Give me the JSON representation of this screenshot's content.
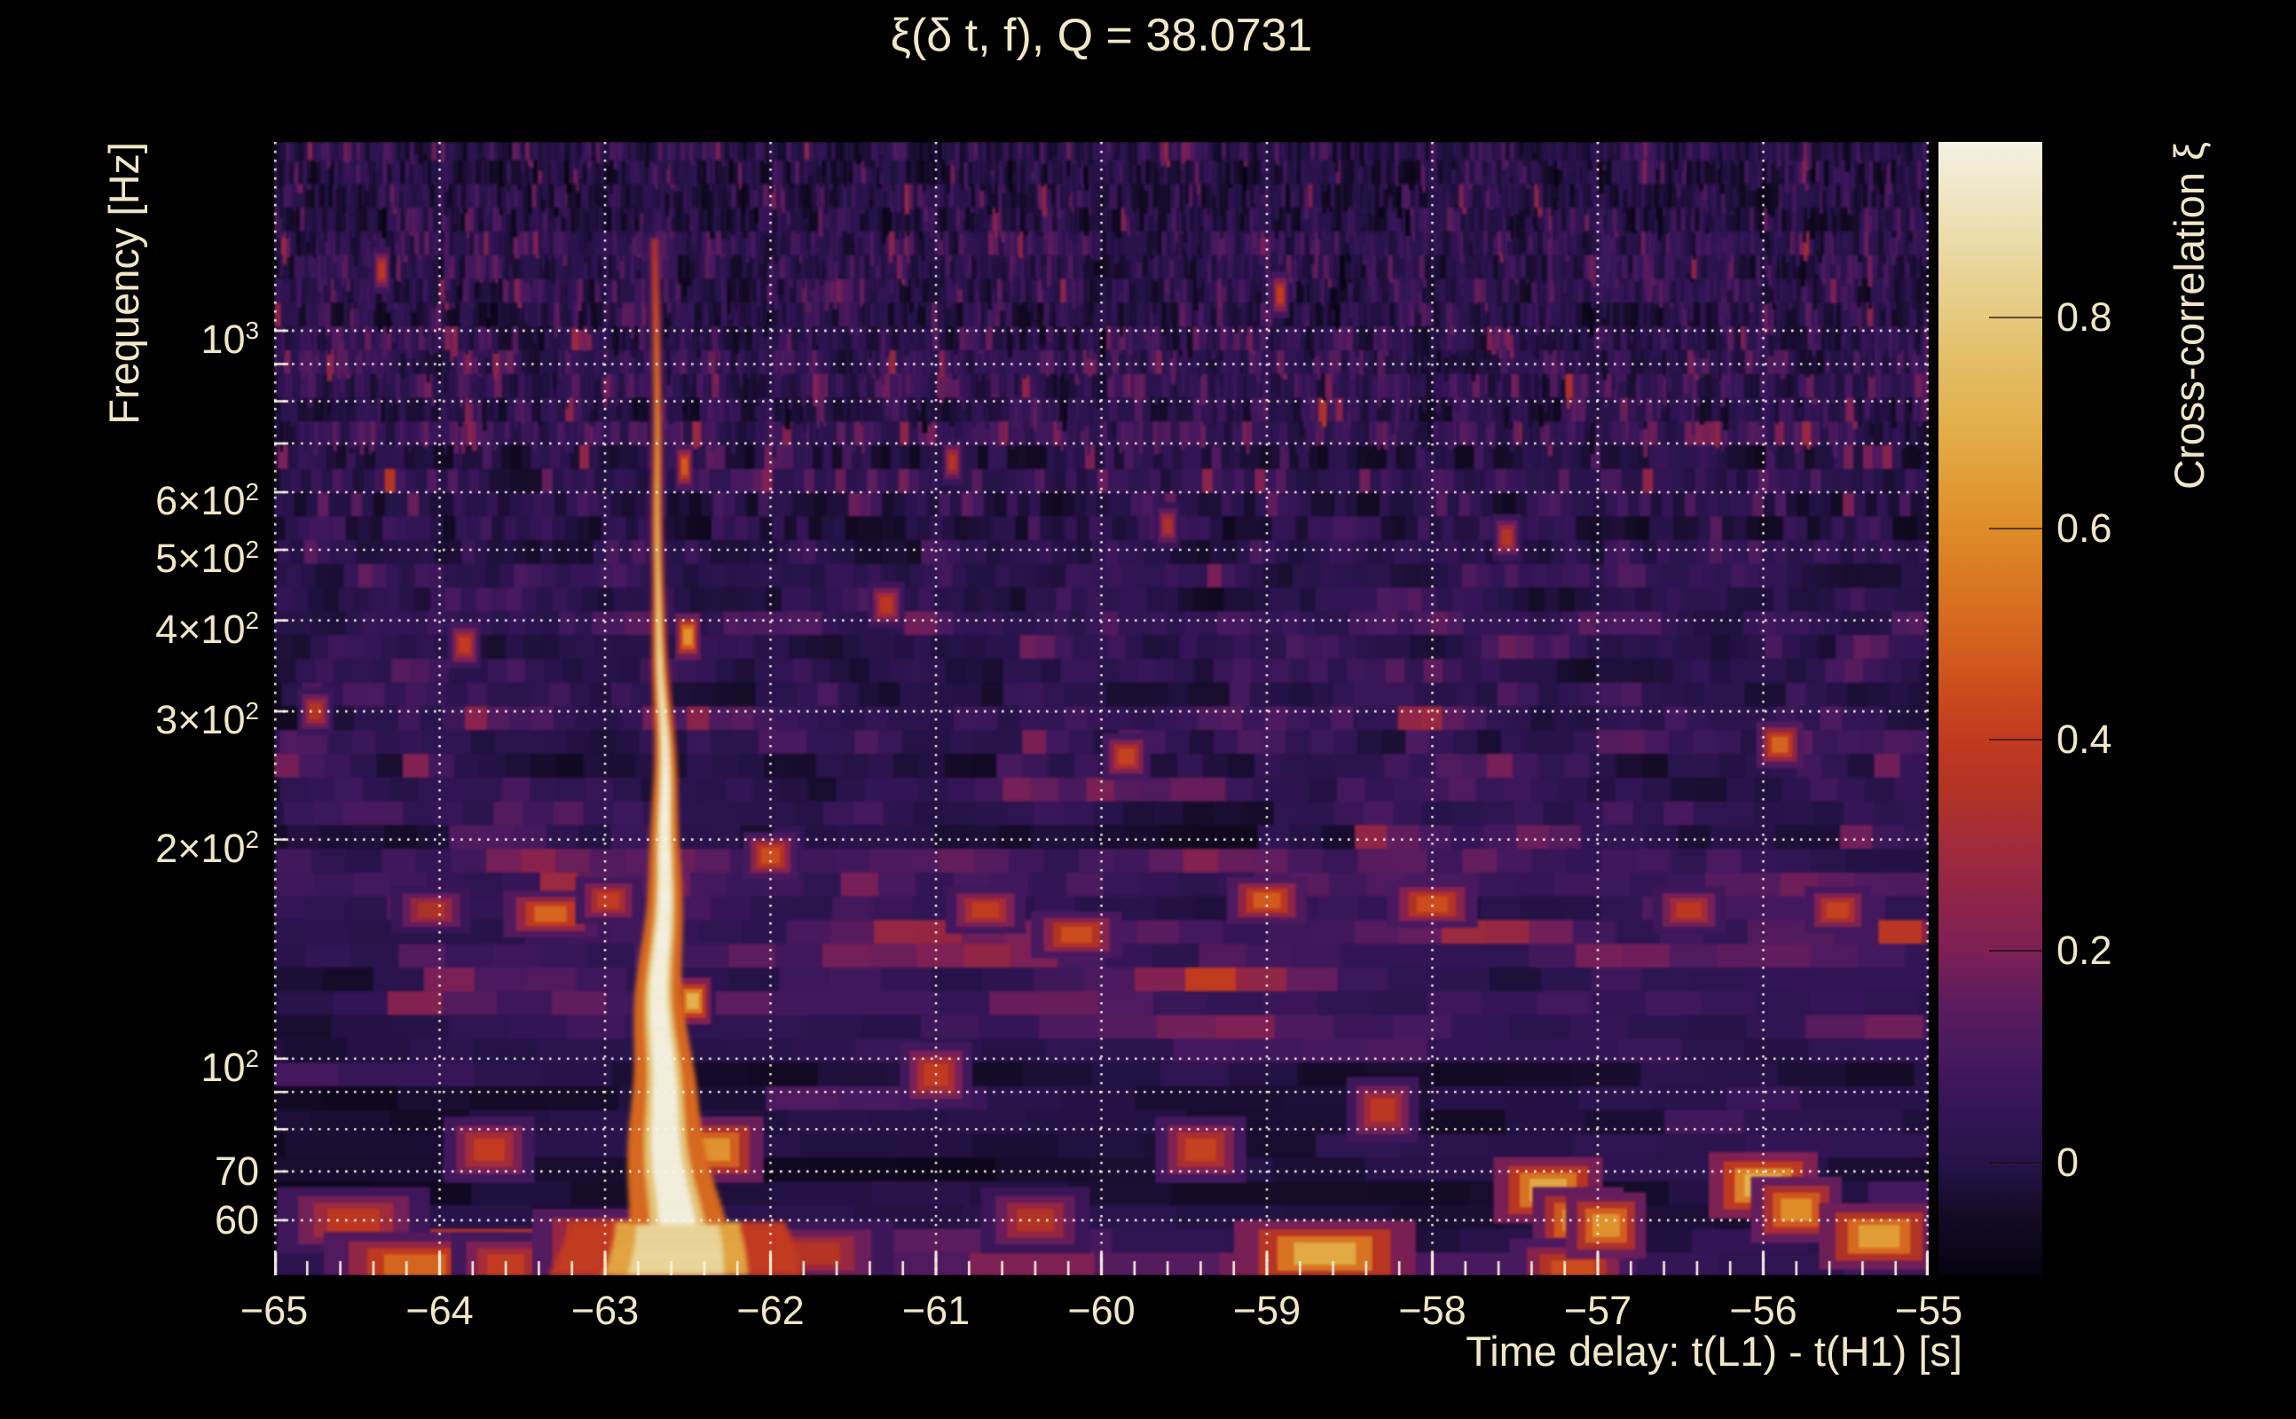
{
  "chart_data": {
    "type": "heatmap",
    "title": "ξ(δ t, f), Q = 38.0731",
    "q_value": 38.0731,
    "xlabel": "Time delay: t(L1) - t(H1) [s]",
    "ylabel": "Frequency [Hz]",
    "colorbar_label": "Cross-correlation ξ",
    "x_range_s": [
      -65,
      -55
    ],
    "x_minor_step_s": 0.2,
    "y_range_hz": [
      50.4,
      1817
    ],
    "y_scale": "log",
    "grid": "dotted white at integer seconds and at log-decade frequencies",
    "x_ticks": [
      {
        "value": -65,
        "label": "−65"
      },
      {
        "value": -64,
        "label": "−64"
      },
      {
        "value": -63,
        "label": "−63"
      },
      {
        "value": -62,
        "label": "−62"
      },
      {
        "value": -61,
        "label": "−61"
      },
      {
        "value": -60,
        "label": "−60"
      },
      {
        "value": -59,
        "label": "−59"
      },
      {
        "value": -58,
        "label": "−58"
      },
      {
        "value": -57,
        "label": "−57"
      },
      {
        "value": -56,
        "label": "−56"
      },
      {
        "value": -55,
        "label": "−55"
      }
    ],
    "y_grid_freqs_hz": [
      60,
      70,
      80,
      90,
      100,
      200,
      300,
      400,
      500,
      600,
      700,
      800,
      900,
      1000
    ],
    "y_tick_labels": [
      {
        "f": 1000,
        "base": "10",
        "exp": "3"
      },
      {
        "f": 600,
        "base": "6×10",
        "exp": "2"
      },
      {
        "f": 500,
        "base": "5×10",
        "exp": "2"
      },
      {
        "f": 400,
        "base": "4×10",
        "exp": "2"
      },
      {
        "f": 300,
        "base": "3×10",
        "exp": "2"
      },
      {
        "f": 200,
        "base": "2×10",
        "exp": "2"
      },
      {
        "f": 100,
        "base": "10",
        "exp": "2"
      },
      {
        "f": 70,
        "base": "70",
        "exp": ""
      },
      {
        "f": 60,
        "base": "60",
        "exp": ""
      }
    ],
    "colorbar": {
      "vmin": -0.107,
      "vmax": 0.966,
      "ticks": [
        {
          "value": 0.8,
          "label": "0.8"
        },
        {
          "value": 0.6,
          "label": "0.6"
        },
        {
          "value": 0.4,
          "label": "0.4"
        },
        {
          "value": 0.2,
          "label": "0.2"
        },
        {
          "value": 0,
          "label": "0"
        }
      ]
    },
    "colormap_stops": [
      [
        -0.107,
        "#060310"
      ],
      [
        -0.05,
        "#140b26"
      ],
      [
        0.0,
        "#261349"
      ],
      [
        0.05,
        "#331556"
      ],
      [
        0.1,
        "#47195f"
      ],
      [
        0.15,
        "#5c1c5e"
      ],
      [
        0.2,
        "#7d2055"
      ],
      [
        0.25,
        "#8f2448"
      ],
      [
        0.3,
        "#a02b3b"
      ],
      [
        0.35,
        "#b23325"
      ],
      [
        0.4,
        "#c23a20"
      ],
      [
        0.45,
        "#cc4c1d"
      ],
      [
        0.5,
        "#d5641e"
      ],
      [
        0.55,
        "#d97823"
      ],
      [
        0.6,
        "#de8c28"
      ],
      [
        0.65,
        "#e19e38"
      ],
      [
        0.7,
        "#e2b04c"
      ],
      [
        0.75,
        "#e3bb62"
      ],
      [
        0.8,
        "#e5c97e"
      ],
      [
        0.85,
        "#e9d69b"
      ],
      [
        0.9,
        "#eee2ba"
      ],
      [
        0.966,
        "#f4f1e4"
      ]
    ],
    "signal": {
      "description": "bright chirp track of high cross-correlation",
      "t_top_s": -62.7,
      "t_bottom_s": -62.6,
      "f_low_hz": 50,
      "f_high_hz": 1320,
      "peak_xi": 0.96
    },
    "hot_spots": [
      {
        "t": -64.52,
        "f": 60,
        "dt": 0.42,
        "v": 0.38
      },
      {
        "t": -64.15,
        "f": 52,
        "dt": 0.5,
        "v": 0.5
      },
      {
        "t": -64.05,
        "f": 160,
        "dt": 0.22,
        "v": 0.34
      },
      {
        "t": -64.35,
        "f": 1210,
        "dt": 0.05,
        "v": 0.38
      },
      {
        "t": -64.75,
        "f": 300,
        "dt": 0.1,
        "v": 0.36
      },
      {
        "t": -63.85,
        "f": 370,
        "dt": 0.09,
        "v": 0.4
      },
      {
        "t": -63.7,
        "f": 75,
        "dt": 0.25,
        "v": 0.4
      },
      {
        "t": -63.6,
        "f": 52,
        "dt": 0.3,
        "v": 0.4
      },
      {
        "t": -63.33,
        "f": 158,
        "dt": 0.26,
        "v": 0.5
      },
      {
        "t": -63.0,
        "f": 56,
        "dt": 0.4,
        "v": 0.52
      },
      {
        "t": -62.98,
        "f": 165,
        "dt": 0.18,
        "v": 0.4
      },
      {
        "t": -62.66,
        "f": 53,
        "dt": 0.5,
        "v": 0.55
      },
      {
        "t": -62.5,
        "f": 380,
        "dt": 0.07,
        "v": 0.62
      },
      {
        "t": -62.52,
        "f": 650,
        "dt": 0.05,
        "v": 0.48
      },
      {
        "t": -62.47,
        "f": 120,
        "dt": 0.1,
        "v": 0.7
      },
      {
        "t": -62.35,
        "f": 75,
        "dt": 0.28,
        "v": 0.62
      },
      {
        "t": -62.0,
        "f": 190,
        "dt": 0.15,
        "v": 0.45
      },
      {
        "t": -61.75,
        "f": 54,
        "dt": 0.45,
        "v": 0.36
      },
      {
        "t": -61.3,
        "f": 420,
        "dt": 0.1,
        "v": 0.38
      },
      {
        "t": -61.0,
        "f": 95,
        "dt": 0.2,
        "v": 0.4
      },
      {
        "t": -60.9,
        "f": 660,
        "dt": 0.06,
        "v": 0.35
      },
      {
        "t": -60.7,
        "f": 160,
        "dt": 0.22,
        "v": 0.4
      },
      {
        "t": -60.4,
        "f": 60,
        "dt": 0.3,
        "v": 0.35
      },
      {
        "t": -60.15,
        "f": 148,
        "dt": 0.25,
        "v": 0.45
      },
      {
        "t": -59.85,
        "f": 260,
        "dt": 0.13,
        "v": 0.42
      },
      {
        "t": -59.6,
        "f": 540,
        "dt": 0.07,
        "v": 0.33
      },
      {
        "t": -59.4,
        "f": 75,
        "dt": 0.25,
        "v": 0.42
      },
      {
        "t": -59.0,
        "f": 165,
        "dt": 0.22,
        "v": 0.48
      },
      {
        "t": -58.92,
        "f": 1120,
        "dt": 0.05,
        "v": 0.4
      },
      {
        "t": -58.65,
        "f": 54,
        "dt": 0.5,
        "v": 0.68
      },
      {
        "t": -58.3,
        "f": 85,
        "dt": 0.2,
        "v": 0.38
      },
      {
        "t": -58.0,
        "f": 163,
        "dt": 0.25,
        "v": 0.45
      },
      {
        "t": -57.55,
        "f": 520,
        "dt": 0.08,
        "v": 0.36
      },
      {
        "t": -57.3,
        "f": 66,
        "dt": 0.3,
        "v": 0.68
      },
      {
        "t": -57.12,
        "f": 60,
        "dt": 0.25,
        "v": 0.6
      },
      {
        "t": -57.15,
        "f": 51,
        "dt": 0.35,
        "v": 0.45
      },
      {
        "t": -56.95,
        "f": 59,
        "dt": 0.22,
        "v": 0.62
      },
      {
        "t": -56.45,
        "f": 160,
        "dt": 0.2,
        "v": 0.38
      },
      {
        "t": -56.0,
        "f": 67,
        "dt": 0.3,
        "v": 0.72
      },
      {
        "t": -55.9,
        "f": 270,
        "dt": 0.13,
        "v": 0.5
      },
      {
        "t": -55.8,
        "f": 62,
        "dt": 0.25,
        "v": 0.6
      },
      {
        "t": -55.55,
        "f": 160,
        "dt": 0.18,
        "v": 0.42
      },
      {
        "t": -55.3,
        "f": 57,
        "dt": 0.33,
        "v": 0.65
      }
    ],
    "noise_floor_xi_range": [
      -0.1,
      0.3
    ]
  },
  "colors": {
    "background": "#000000",
    "text": "#f0e7c7",
    "grid_dots": "#fcf6e3"
  }
}
